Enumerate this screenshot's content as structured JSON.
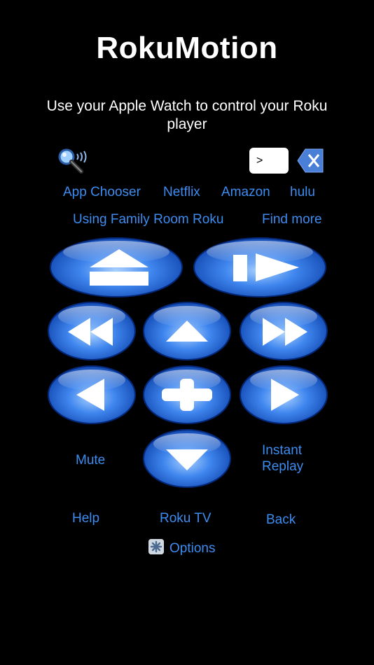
{
  "app": {
    "title": "RokuMotion",
    "subtitle": "Use your Apple Watch to control your Roku player"
  },
  "keyboard": {
    "input_value": ">",
    "search_icon": "search-with-signal-icon",
    "clear_icon": "backspace-x-icon"
  },
  "channels": {
    "app_chooser": "App Chooser",
    "netflix": "Netflix",
    "amazon": "Amazon",
    "hulu": "hulu"
  },
  "device": {
    "using": "Using Family Room Roku",
    "find_more": "Find more"
  },
  "remote": {
    "home_icon": "home-eject-icon",
    "play_pause_icon": "play-pause-icon",
    "rewind_icon": "rewind-icon",
    "up_icon": "up-arrow-icon",
    "fast_forward_icon": "fast-forward-icon",
    "left_icon": "left-arrow-icon",
    "ok_icon": "plus-ok-icon",
    "right_icon": "right-arrow-icon",
    "down_icon": "down-arrow-icon",
    "mute": "Mute",
    "instant_replay": "Instant Replay"
  },
  "footer": {
    "help": "Help",
    "roku_tv": "Roku TV",
    "back": "Back",
    "options": "Options"
  },
  "colors": {
    "background": "#000000",
    "link": "#3d8cf0",
    "button_blue": "#2a6ee0"
  }
}
